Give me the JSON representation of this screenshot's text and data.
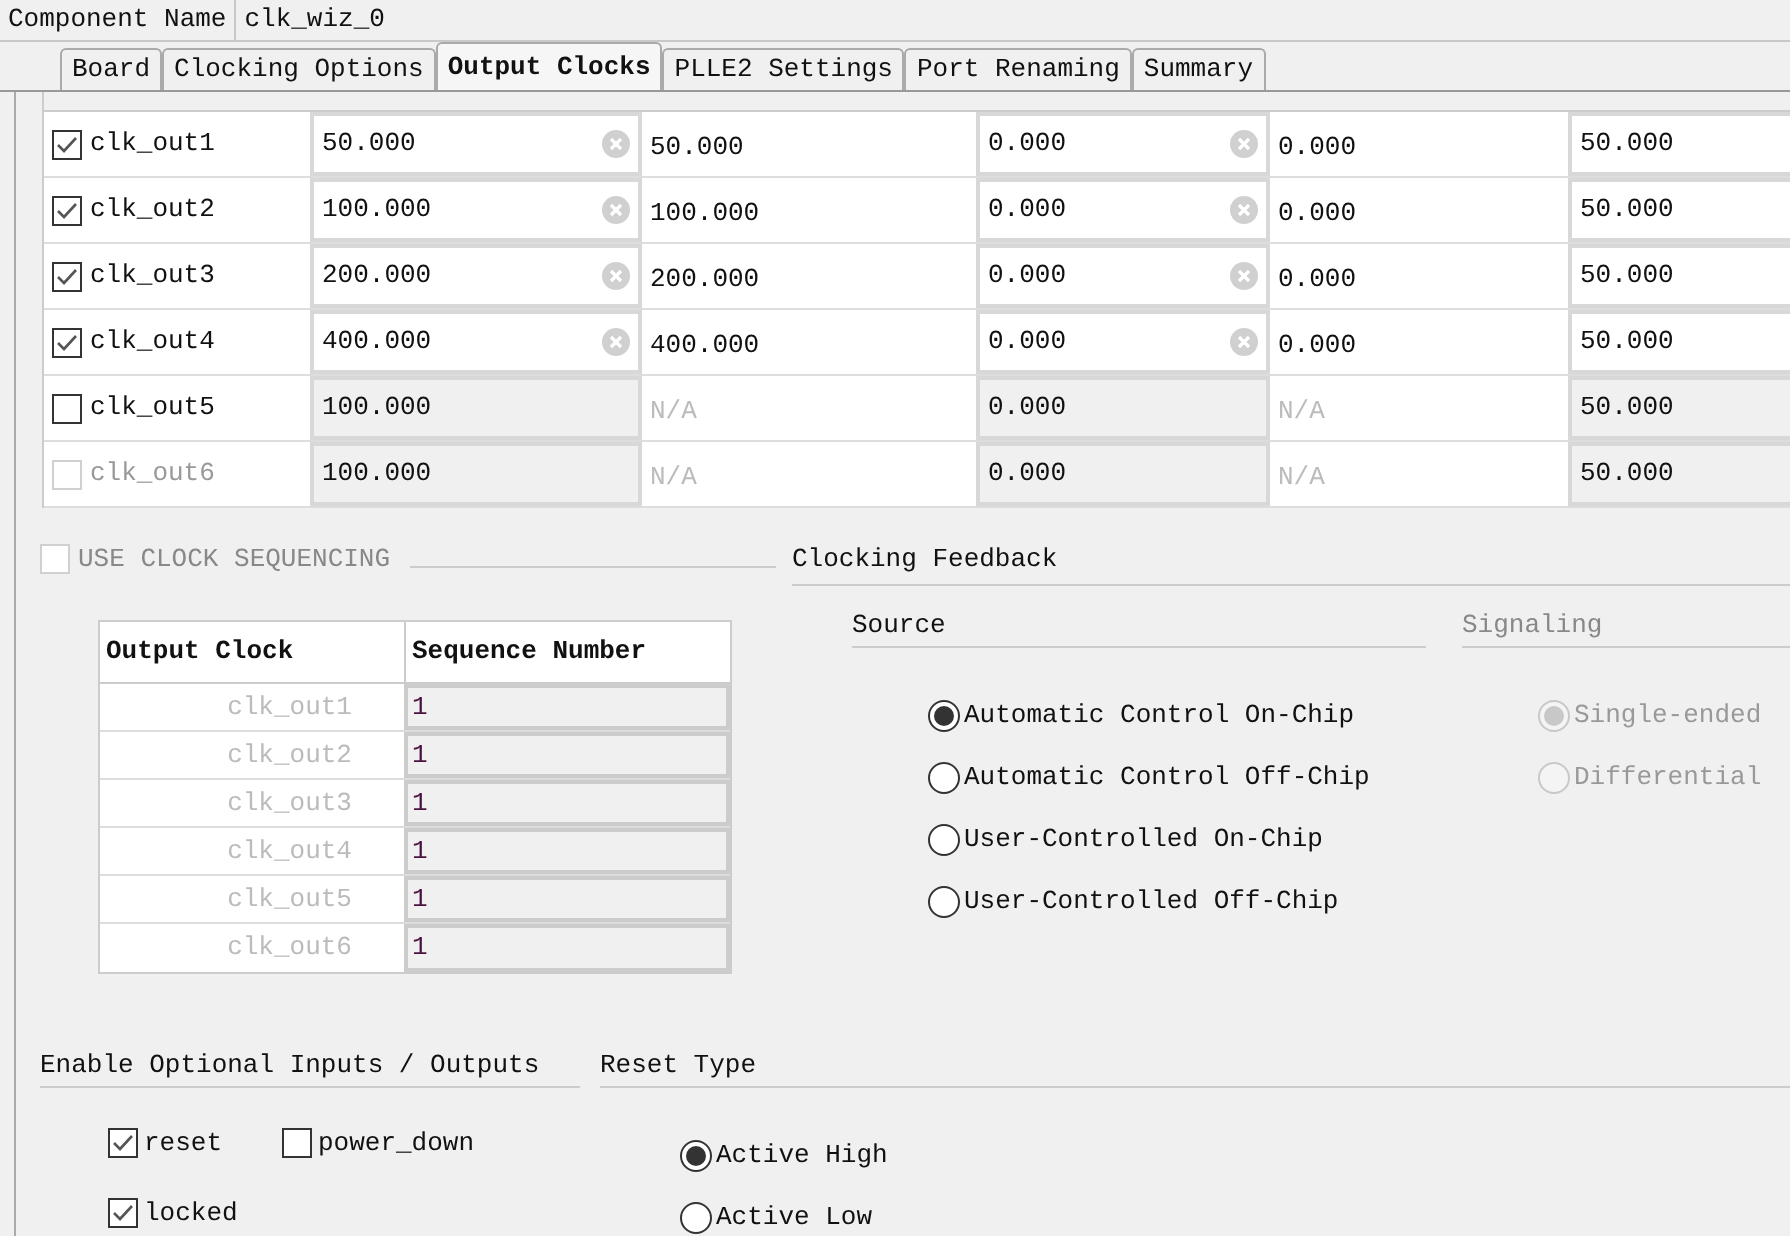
{
  "component_name": {
    "label": "Component Name",
    "value": "clk_wiz_0"
  },
  "tabs": [
    {
      "label": "Board",
      "selected": false
    },
    {
      "label": "Clocking Options",
      "selected": false
    },
    {
      "label": "Output Clocks",
      "selected": true
    },
    {
      "label": "PLLE2 Settings",
      "selected": false
    },
    {
      "label": "Port Renaming",
      "selected": false
    },
    {
      "label": "Summary",
      "selected": false
    }
  ],
  "output_clocks": [
    {
      "name": "clk_out1",
      "checked": true,
      "disabled": false,
      "values": [
        "50.000",
        "50.000",
        "0.000",
        "0.000",
        "50.000"
      ]
    },
    {
      "name": "clk_out2",
      "checked": true,
      "disabled": false,
      "values": [
        "100.000",
        "100.000",
        "0.000",
        "0.000",
        "50.000"
      ]
    },
    {
      "name": "clk_out3",
      "checked": true,
      "disabled": false,
      "values": [
        "200.000",
        "200.000",
        "0.000",
        "0.000",
        "50.000"
      ]
    },
    {
      "name": "clk_out4",
      "checked": true,
      "disabled": false,
      "values": [
        "400.000",
        "400.000",
        "0.000",
        "0.000",
        "50.000"
      ]
    },
    {
      "name": "clk_out5",
      "checked": false,
      "disabled": false,
      "values": [
        "100.000",
        "N/A",
        "0.000",
        "N/A",
        "50.000"
      ]
    },
    {
      "name": "clk_out6",
      "checked": false,
      "disabled": true,
      "values": [
        "100.000",
        "N/A",
        "0.000",
        "N/A",
        "50.000"
      ]
    }
  ],
  "sequencing": {
    "label": "USE CLOCK SEQUENCING",
    "checked": false,
    "disabled": true,
    "columns": [
      "Output Clock",
      "Sequence Number"
    ],
    "rows": [
      {
        "clock": "clk_out1",
        "number": "1"
      },
      {
        "clock": "clk_out2",
        "number": "1"
      },
      {
        "clock": "clk_out3",
        "number": "1"
      },
      {
        "clock": "clk_out4",
        "number": "1"
      },
      {
        "clock": "clk_out5",
        "number": "1"
      },
      {
        "clock": "clk_out6",
        "number": "1"
      }
    ]
  },
  "clocking_feedback": {
    "title": "Clocking Feedback",
    "source": {
      "title": "Source",
      "disabled": false,
      "options": [
        {
          "label": "Automatic Control On-Chip",
          "selected": true
        },
        {
          "label": "Automatic Control Off-Chip",
          "selected": false
        },
        {
          "label": "User-Controlled On-Chip",
          "selected": false
        },
        {
          "label": "User-Controlled Off-Chip",
          "selected": false
        }
      ]
    },
    "signaling": {
      "title": "Signaling",
      "disabled": true,
      "options": [
        {
          "label": "Single-ended",
          "selected": true
        },
        {
          "label": "Differential",
          "selected": false
        }
      ]
    }
  },
  "optional_io": {
    "title": "Enable Optional Inputs / Outputs",
    "options": [
      {
        "label": "reset",
        "checked": true
      },
      {
        "label": "power_down",
        "checked": false
      },
      {
        "label": "locked",
        "checked": true
      }
    ]
  },
  "reset_type": {
    "title": "Reset Type",
    "options": [
      {
        "label": "Active High",
        "selected": true
      },
      {
        "label": "Active Low",
        "selected": false
      }
    ]
  }
}
